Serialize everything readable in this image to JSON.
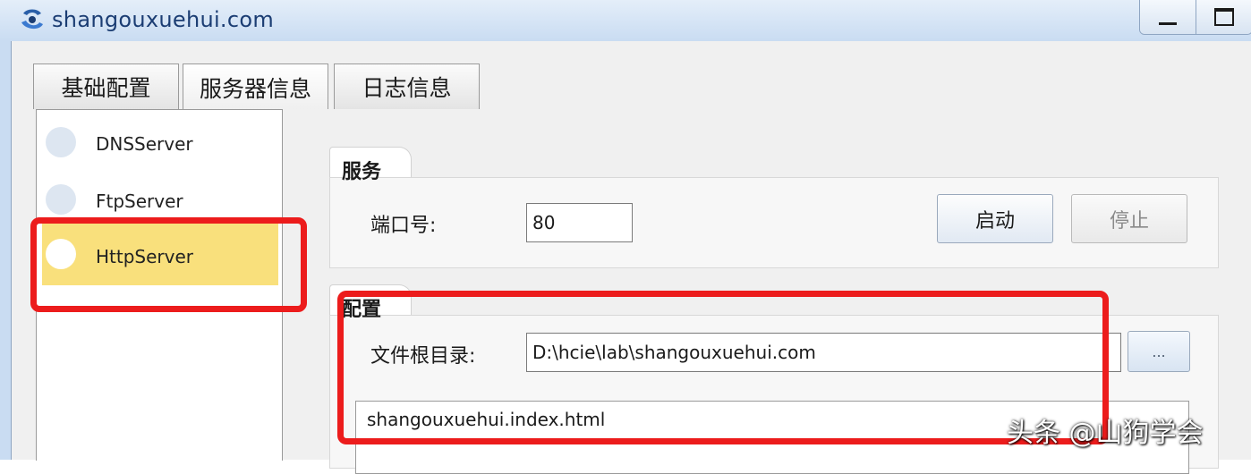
{
  "window": {
    "title": "shangouxuehui.com",
    "minimize_icon": "minimize-icon",
    "maximize_icon": "maximize-icon"
  },
  "tabs": [
    {
      "label": "基础配置"
    },
    {
      "label": "服务器信息"
    },
    {
      "label": "日志信息"
    }
  ],
  "servers": [
    {
      "label": "DNSServer",
      "selected": false
    },
    {
      "label": "FtpServer",
      "selected": false
    },
    {
      "label": "HttpServer",
      "selected": true
    }
  ],
  "service": {
    "group_title": "服务",
    "port_label": "端口号:",
    "port_value": "80",
    "start_label": "启动",
    "stop_label": "停止"
  },
  "config": {
    "group_title": "配置",
    "root_label": "文件根目录:",
    "root_value": "D:\\hcie\\lab\\shangouxuehui.com",
    "browse_label": "...",
    "files": [
      "shangouxuehui.index.html"
    ]
  },
  "watermark": "头条 @山狗学会",
  "colors": {
    "highlight": "#ec1c1c",
    "selected_row": "#f9e07c"
  }
}
